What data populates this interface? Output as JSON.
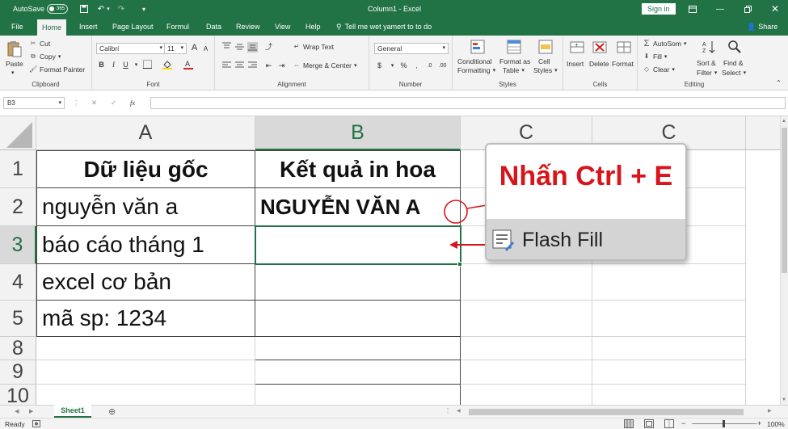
{
  "titlebar": {
    "autosave_label": "AutoSave",
    "autosave_state": "365",
    "doc_title": "Column1 - Excel",
    "signin_label": "Sign in"
  },
  "tabs": [
    "File",
    "Home",
    "Insert",
    "Page Layout",
    "Formul",
    "Data",
    "Review",
    "View",
    "Help"
  ],
  "active_tab": "Home",
  "tell_me": "Tell me wet yamert to to do",
  "share_label": "Share",
  "ribbon": {
    "clipboard": {
      "paste": "Paste",
      "cut": "Cut",
      "copy": "Copy",
      "format_painter": "Format Painter",
      "label": "Clipboard"
    },
    "font": {
      "name": "Calibri",
      "size": "11",
      "label": "Font"
    },
    "alignment": {
      "wrap": "Wrap Text",
      "merge": "Merge & Center",
      "label": "Alignment"
    },
    "number": {
      "format": "General",
      "label": "Number"
    },
    "styles": {
      "conditional": "Conditional",
      "conditional2": "Formatting",
      "format_as": "Format as",
      "format_as2": "Table",
      "cell": "Cell",
      "cell2": "Styles",
      "label": "Styles"
    },
    "cells": {
      "insert": "Insert",
      "delete": "Delete",
      "format": "Format",
      "label": "Cells"
    },
    "editing": {
      "autosum": "AutoSom",
      "fill": "Fill",
      "clear": "Clear",
      "sort": "Sort &",
      "sort2": "Filter",
      "find": "Find &",
      "find2": "Select",
      "label": "Editing"
    }
  },
  "formula_bar": {
    "name_box": "B3",
    "fx": "fx",
    "formula": ""
  },
  "columns": [
    "A",
    "B",
    "C",
    "C"
  ],
  "rows": [
    "1",
    "2",
    "3",
    "4",
    "5",
    "8",
    "9",
    "10"
  ],
  "cells": {
    "A1": "Dữ liệu gốc",
    "B1": "Kết quả in hoa",
    "A2": "nguyễn văn a",
    "B2": "NGUYỄN VĂN A",
    "A3": "báo cáo tháng 1",
    "A4": "excel cơ bản",
    "A5": "mã sp: 1234"
  },
  "popup": {
    "hint": "Nhấn Ctrl + E",
    "item": "Flash Fill"
  },
  "sheet_tab": "Sheet1",
  "status": {
    "ready": "Ready",
    "zoom": "100%"
  },
  "colors": {
    "excel_green": "#217346",
    "hint_red": "#d7161b"
  }
}
